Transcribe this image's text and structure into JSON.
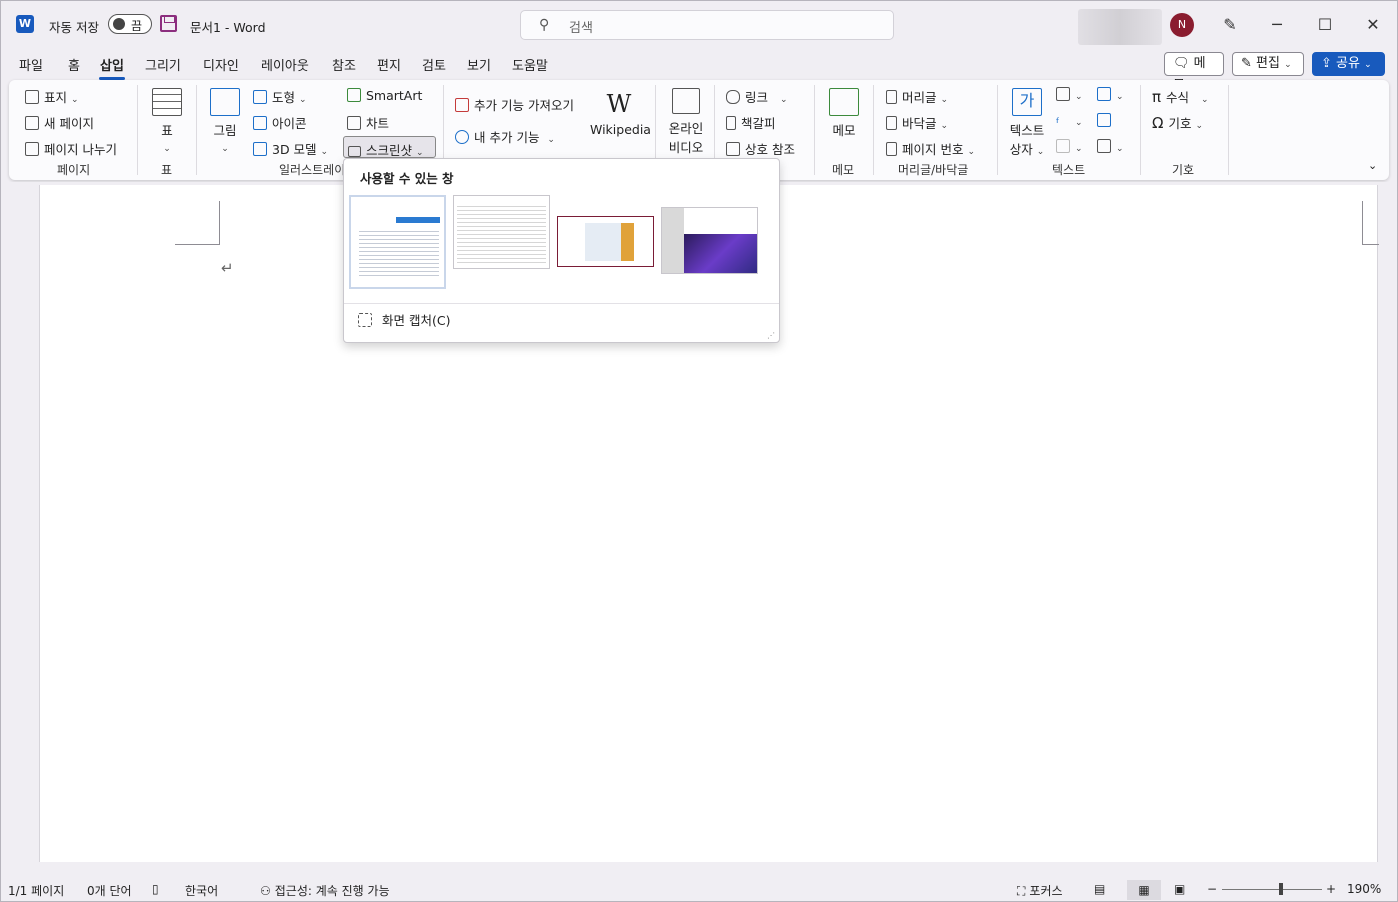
{
  "titlebar": {
    "autosave_label": "자동 저장",
    "autosave_state": "끔",
    "doc_title": "문서1  -  Word",
    "search_placeholder": "검색",
    "avatar_initial": "N"
  },
  "tabs": [
    "파일",
    "홈",
    "삽입",
    "그리기",
    "디자인",
    "레이아웃",
    "참조",
    "편지",
    "검토",
    "보기",
    "도움말"
  ],
  "active_tab": "삽입",
  "top_buttons": {
    "comment": "메모",
    "edit": "편집",
    "share": "공유"
  },
  "ribbon": {
    "pages": {
      "cover": "표지",
      "new_page": "새 페이지",
      "page_break": "페이지 나누기",
      "group": "페이지"
    },
    "table": {
      "table": "표",
      "group": "표"
    },
    "illustrations": {
      "pictures": "그림",
      "shapes": "도형",
      "icons": "아이콘",
      "models3d": "3D 모델",
      "smartart": "SmartArt",
      "chart": "차트",
      "screenshot": "스크린샷",
      "group": "일러스트레이"
    },
    "addins": {
      "get": "추가 기능 가져오기",
      "my": "내 추가 기능",
      "wikipedia": "Wikipedia"
    },
    "media": {
      "online_video_1": "온라인",
      "online_video_2": "비디오"
    },
    "links": {
      "link": "링크",
      "bookmark": "책갈피",
      "cross_ref": "상호 참조"
    },
    "comments": {
      "new_comment": "메모",
      "group": "메모"
    },
    "header_footer": {
      "header": "머리글",
      "footer": "바닥글",
      "page_number": "페이지 번호",
      "group": "머리글/바닥글"
    },
    "text": {
      "textbox_1": "텍스트",
      "textbox_2": "상자",
      "dropcap": "가",
      "group": "텍스트"
    },
    "symbols": {
      "equation": "수식",
      "symbol": "기호",
      "group": "기호"
    }
  },
  "screenshot_dropdown": {
    "header": "사용할 수 있는 창",
    "thumbnails": [
      "window-1",
      "window-2",
      "window-3",
      "window-4"
    ],
    "screen_clipping": "화면 캡처(C)"
  },
  "document": {
    "paragraph_mark": "↵"
  },
  "statusbar": {
    "page": "1/1 페이지",
    "words": "0개 단어",
    "language": "한국어",
    "accessibility": "접근성: 계속 진행 가능",
    "focus": "포커스",
    "zoom": "190%"
  },
  "colors": {
    "accent": "#185abd",
    "avatar": "#8a1c2f",
    "save_icon": "#8c2e7e"
  }
}
